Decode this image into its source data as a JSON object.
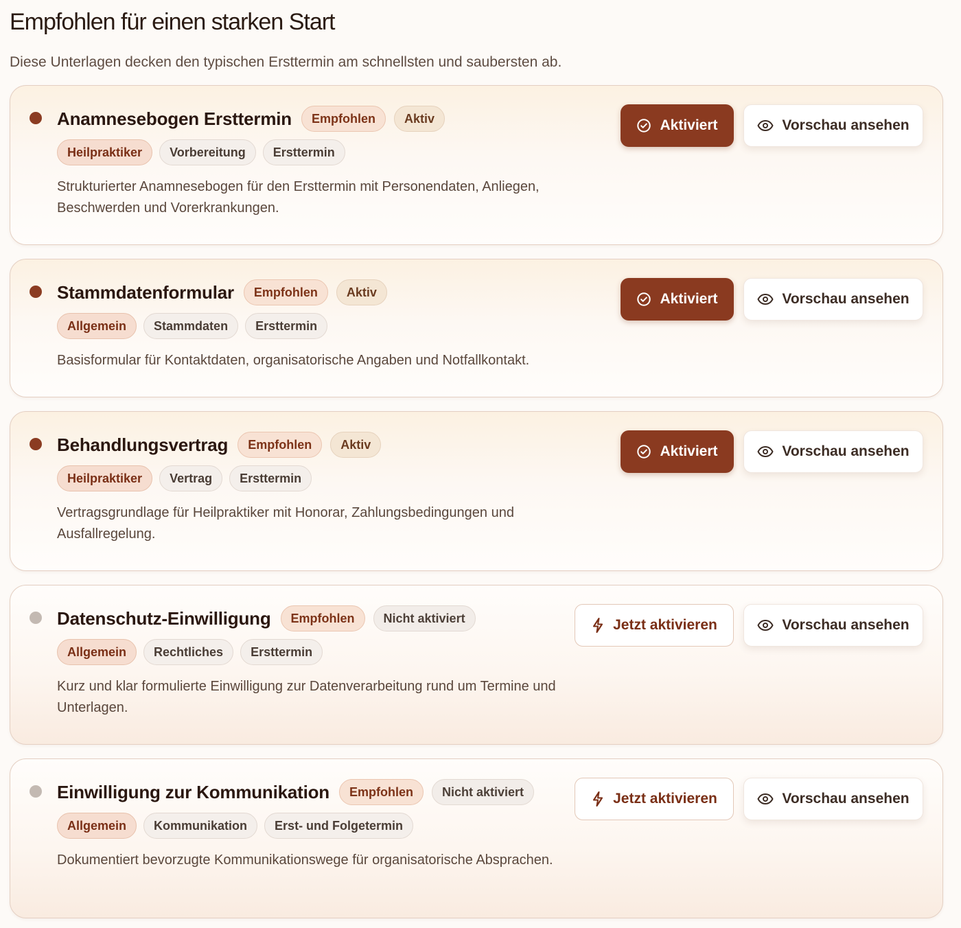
{
  "header": {
    "title": "Empfohlen für einen starken Start",
    "subtitle": "Diese Unterlagen decken den typischen Ersttermin am schnellsten und saubersten ab."
  },
  "labels": {
    "recommended": "Empfohlen",
    "status_active": "Aktiv",
    "status_inactive": "Nicht aktiviert",
    "btn_activated": "Aktiviert",
    "btn_activate": "Jetzt aktivieren",
    "btn_preview": "Vorschau ansehen"
  },
  "colors": {
    "accent": "#8a3a20",
    "accent_text": "#7a2f16",
    "dot_active": "#8b3c22",
    "dot_inactive": "#c3b9b2"
  },
  "icons": {
    "activated": "check-circle-icon",
    "activate": "lightning-icon",
    "preview": "eye-icon"
  },
  "cards": [
    {
      "title": "Anamnesebogen Ersttermin",
      "active": true,
      "tags": [
        "Heilpraktiker",
        "Vorbereitung",
        "Ersttermin"
      ],
      "description": "Strukturierter Anamnesebogen für den Ersttermin mit Personendaten, Anliegen, Beschwerden und Vorerkrankungen."
    },
    {
      "title": "Stammdatenformular",
      "active": true,
      "tags": [
        "Allgemein",
        "Stammdaten",
        "Ersttermin"
      ],
      "description": "Basisformular für Kontaktdaten, organisatorische Angaben und Notfallkontakt."
    },
    {
      "title": "Behandlungsvertrag",
      "active": true,
      "tags": [
        "Heilpraktiker",
        "Vertrag",
        "Ersttermin"
      ],
      "description": "Vertragsgrundlage für Heilpraktiker mit Honorar, Zahlungsbedingungen und Ausfallregelung."
    },
    {
      "title": "Datenschutz-Einwilligung",
      "active": false,
      "tags": [
        "Allgemein",
        "Rechtliches",
        "Ersttermin"
      ],
      "description": "Kurz und klar formulierte Einwilligung zur Datenverarbeitung rund um Termine und Unterlagen."
    },
    {
      "title": "Einwilligung zur Kommunikation",
      "active": false,
      "tags": [
        "Allgemein",
        "Kommunikation",
        "Erst- und Folgetermin"
      ],
      "description": "Dokumentiert bevorzugte Kommunikationswege für organisatorische Absprachen."
    }
  ]
}
